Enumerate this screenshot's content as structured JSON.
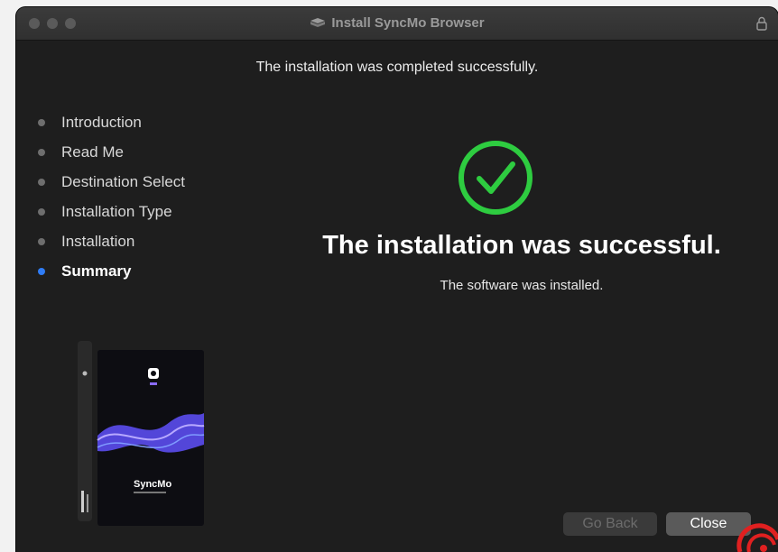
{
  "window": {
    "title": "Install SyncMo Browser"
  },
  "header": {
    "message": "The installation was completed successfully."
  },
  "sidebar": {
    "steps": [
      {
        "label": "Introduction",
        "active": false
      },
      {
        "label": "Read Me",
        "active": false
      },
      {
        "label": "Destination Select",
        "active": false
      },
      {
        "label": "Installation Type",
        "active": false
      },
      {
        "label": "Installation",
        "active": false
      },
      {
        "label": "Summary",
        "active": true
      }
    ]
  },
  "main": {
    "status_icon": "checkmark-circle-icon",
    "title": "The installation was successful.",
    "subtitle": "The software was installed."
  },
  "buttons": {
    "back_label": "Go Back",
    "close_label": "Close"
  },
  "product": {
    "box_label": "SyncMo"
  },
  "colors": {
    "success": "#2ecc40",
    "active_step": "#2f7cf6",
    "window_bg": "#1e1e1e"
  }
}
